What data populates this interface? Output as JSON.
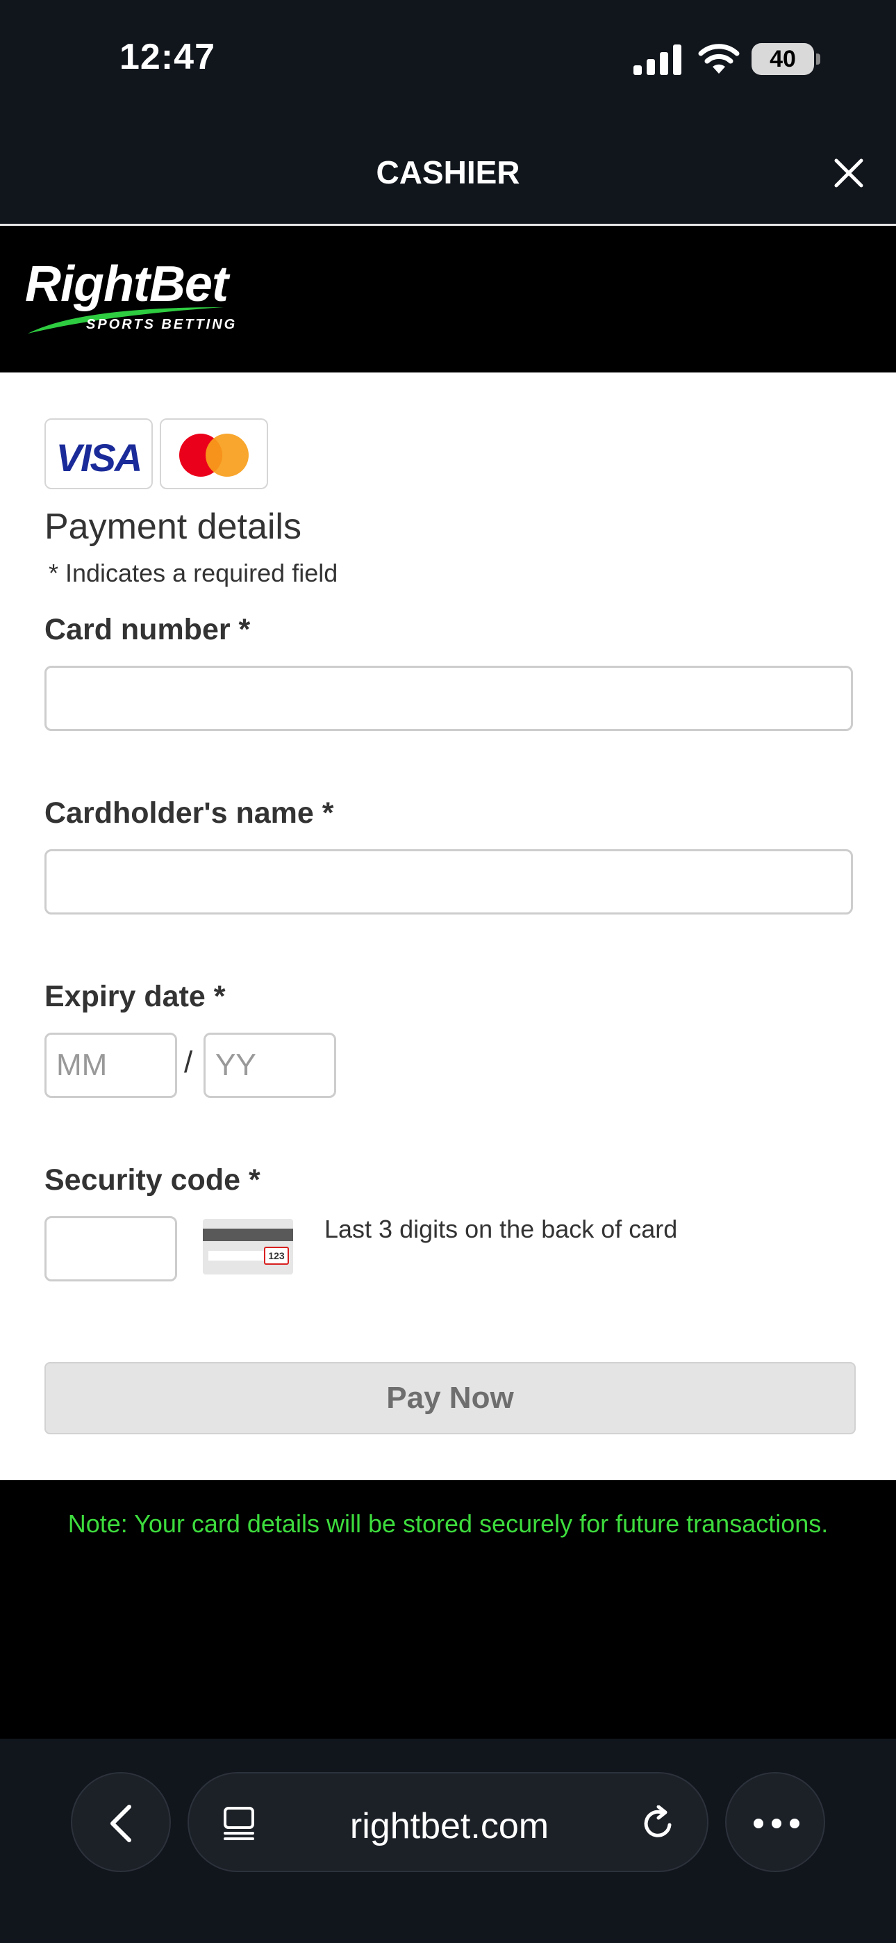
{
  "status_bar": {
    "time": "12:47",
    "battery": "40",
    "icons": [
      "signal-icon",
      "wifi-icon",
      "battery-icon"
    ]
  },
  "header": {
    "title": "CASHIER",
    "close_icon": "close-icon"
  },
  "brand": {
    "name": "RightBet",
    "tagline": "SPORTS BETTING",
    "accent": "#2ecc40"
  },
  "payment": {
    "card_logos": [
      "visa-logo",
      "mastercard-logo"
    ],
    "visa_text": "VISA",
    "section_title": "Payment details",
    "required_note": "* Indicates a required field",
    "card_number_label": "Card number  *",
    "card_number_value": "",
    "cardholder_label": "Cardholder's name  *",
    "cardholder_value": "",
    "expiry_label": "Expiry date  *",
    "expiry_month_placeholder": "MM",
    "expiry_separator": "/",
    "expiry_year_placeholder": "YY",
    "security_label": "Security code  *",
    "security_value": "",
    "cvv_sample": "123",
    "security_hint": "Last 3 digits on the back of card",
    "pay_button": "Pay Now"
  },
  "note": "Note: Your card details will be stored securely for future transactions.",
  "browser": {
    "url": "rightbet.com",
    "icons": [
      "back-icon",
      "tabs-icon",
      "reload-icon",
      "more-icon"
    ]
  },
  "colors": {
    "header_bg": "#11151c",
    "note_text": "#3ddc3d",
    "visa_blue": "#1a2b99",
    "mc_red": "#eb001b",
    "mc_orange": "#f79e1b"
  }
}
